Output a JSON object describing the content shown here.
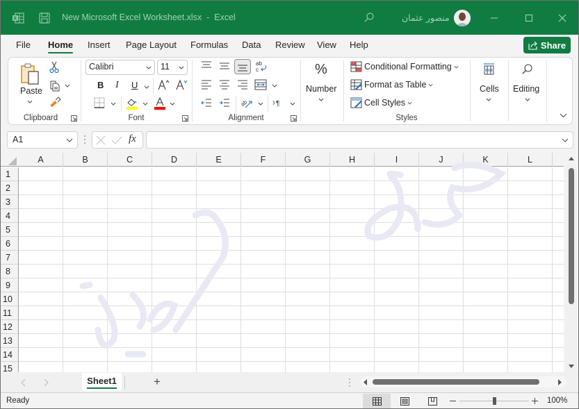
{
  "titlebar": {
    "title": "New Microsoft Excel Worksheet.xlsx  -  Excel",
    "user_name": "منصور عثمان",
    "icons": [
      "excel-app-icon",
      "save-icon",
      "search-icon",
      "minimize-icon",
      "maximize-icon",
      "close-icon"
    ]
  },
  "menu": {
    "tabs": [
      "File",
      "Home",
      "Insert",
      "Page Layout",
      "Formulas",
      "Data",
      "Review",
      "View",
      "Help"
    ],
    "active_tab": "Home",
    "share_label": "Share"
  },
  "ribbon": {
    "clipboard": {
      "label": "Clipboard",
      "paste_label": "Paste"
    },
    "font": {
      "label": "Font",
      "font_name": "Calibri",
      "font_size": "11",
      "bold": "B",
      "italic": "I",
      "underline": "U",
      "fill_color": "#ffff00",
      "font_color": "#ff0000"
    },
    "alignment": {
      "label": "Alignment"
    },
    "number": {
      "label": "Number",
      "icon": "%"
    },
    "styles": {
      "label": "Styles",
      "conditional_formatting": "Conditional Formatting",
      "format_as_table": "Format as Table",
      "cell_styles": "Cell Styles"
    },
    "cells": {
      "label": "Cells"
    },
    "editing": {
      "label": "Editing"
    }
  },
  "formula_bar": {
    "name_box": "A1",
    "fx": "fx",
    "formula": ""
  },
  "sheet": {
    "columns": [
      "A",
      "B",
      "C",
      "D",
      "E",
      "F",
      "G",
      "H",
      "I",
      "J",
      "K",
      "L"
    ],
    "rows": [
      "1",
      "2",
      "3",
      "4",
      "5",
      "6",
      "7",
      "8",
      "9",
      "10",
      "11",
      "12",
      "13",
      "14",
      "15"
    ],
    "selected_cell": "A1"
  },
  "sheet_tabs": {
    "tabs": [
      "Sheet1"
    ],
    "active": "Sheet1",
    "add_label": "+"
  },
  "statusbar": {
    "status": "Ready",
    "zoom": "100%",
    "zoom_value_percent": 100
  },
  "colors": {
    "brand": "#107c41",
    "fill_color_swatch": "#ffff00",
    "font_color_swatch": "#ff0000"
  }
}
